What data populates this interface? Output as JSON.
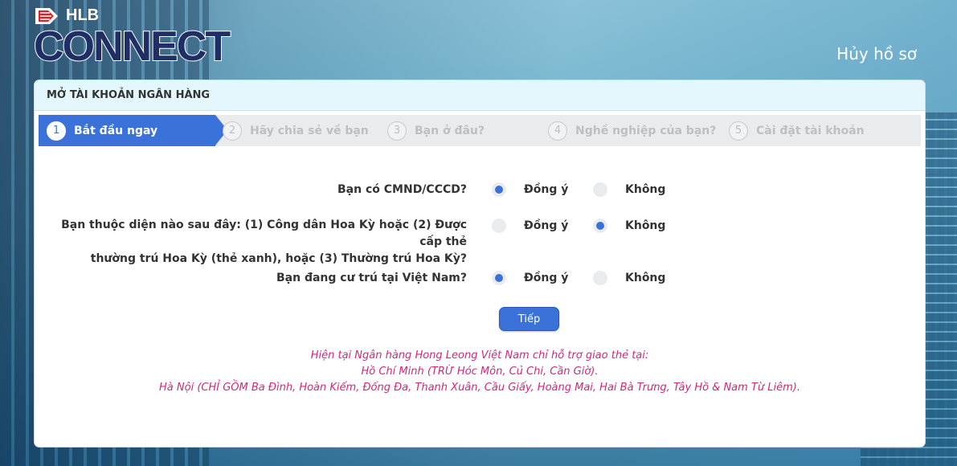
{
  "brand": {
    "top_text": "HLB",
    "main_text": "CONNECT"
  },
  "header": {
    "cancel_label": "Hủy hồ sơ"
  },
  "panel": {
    "title": "MỞ TÀI KHOẢN NGÂN HÀNG"
  },
  "steps": [
    {
      "num": "1",
      "label": "Bắt đầu ngay",
      "active": true
    },
    {
      "num": "2",
      "label": "Hãy chia sẻ về bạn",
      "active": false
    },
    {
      "num": "3",
      "label": "Bạn ở đâu?",
      "active": false
    },
    {
      "num": "4",
      "label": "Nghề nghiệp của bạn?",
      "active": false
    },
    {
      "num": "5",
      "label": "Cài đặt tài khoản",
      "active": false
    }
  ],
  "questions": [
    {
      "label_line1": "Bạn có CMND/CCCD?",
      "label_line2": "",
      "yes": "Đồng ý",
      "no": "Không",
      "selected": "yes"
    },
    {
      "label_line1": "Bạn thuộc diện nào sau đây: (1) Công dân Hoa Kỳ hoặc (2) Được cấp thẻ",
      "label_line2": "thường trú Hoa Kỳ (thẻ xanh), hoặc (3) Thường trú Hoa Kỳ?",
      "yes": "Đồng ý",
      "no": "Không",
      "selected": "no"
    },
    {
      "label_line1": "Bạn đang cư trú tại Việt Nam?",
      "label_line2": "",
      "yes": "Đồng ý",
      "no": "Không",
      "selected": "yes"
    }
  ],
  "next_label": "Tiếp",
  "notice": {
    "line1": "Hiện tại Ngân hàng Hong Leong Việt Nam chỉ hỗ trợ giao thẻ tại:",
    "line2": "Hồ Chí Minh (TRỪ Hóc Môn, Củ Chi, Cần Giờ).",
    "line3": "Hà Nội (CHỈ GỒM Ba Đình, Hoàn Kiếm, Đống Đa, Thanh Xuân, Cầu Giấy, Hoàng Mai, Hai Bà Trưng, Tây Hồ & Nam Từ Liêm)."
  },
  "colors": {
    "accent": "#3b72d9",
    "notice": "#cc2a7a",
    "header_bg": "#e3f7fc"
  }
}
